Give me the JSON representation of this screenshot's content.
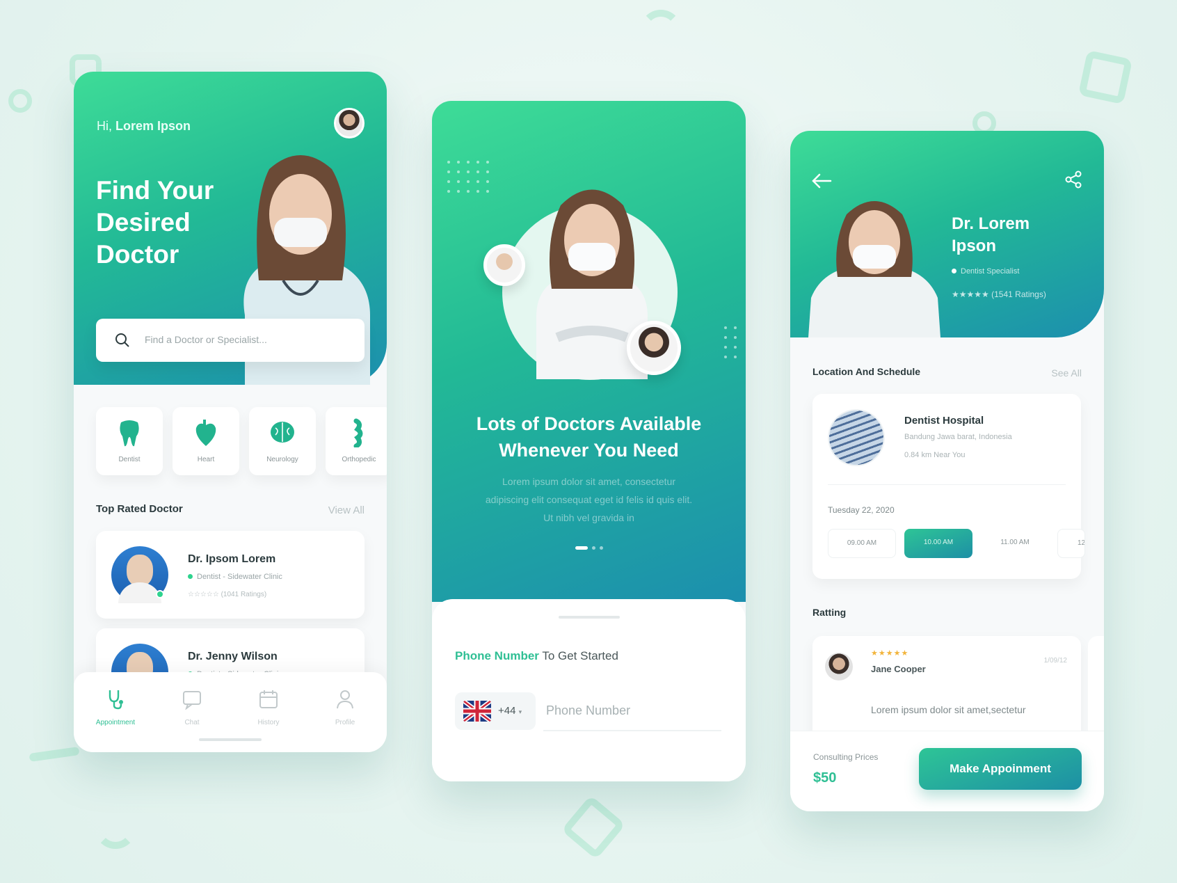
{
  "colors": {
    "accent": "#2fbf94",
    "gradient_start": "#3edc97",
    "gradient_end": "#1c8fae",
    "star": "#f2b43b"
  },
  "home": {
    "greeting_prefix": "Hi,",
    "user_name": "Lorem Ipson",
    "hero_title": "Find Your Desired Doctor",
    "search_placeholder": "Find a Doctor or Specialist...",
    "categories": [
      {
        "label": "Dentist",
        "icon": "tooth-icon"
      },
      {
        "label": "Heart",
        "icon": "heart-icon"
      },
      {
        "label": "Neurology",
        "icon": "brain-icon"
      },
      {
        "label": "Orthopedic",
        "icon": "bone-icon"
      }
    ],
    "top_rated_title": "Top Rated Doctor",
    "view_all": "View All",
    "doctors": [
      {
        "name": "Dr. Ipsom Lorem",
        "specialty": "Dentist - Sidewater Clinic",
        "rating": "☆☆☆☆☆ (1041 Ratings)"
      },
      {
        "name": "Dr. Jenny Wilson",
        "specialty": "Dentist - Sidewater Clinic",
        "rating": ""
      }
    ],
    "tabs": [
      {
        "label": "Appointment",
        "icon": "stethoscope-icon"
      },
      {
        "label": "Chat",
        "icon": "chat-icon"
      },
      {
        "label": "History",
        "icon": "calendar-icon"
      },
      {
        "label": "Profile",
        "icon": "user-icon"
      }
    ]
  },
  "onboarding": {
    "title": "Lots of Doctors Available Whenever You Need",
    "body": "Lorem ipsum dolor sit amet, consectetur adipiscing elit consequat eget id felis id quis elit. Ut nibh vel gravida in",
    "phone_label_bold": "Phone Number",
    "phone_label_rest": "To Get Started",
    "country_code": "+44",
    "phone_placeholder": "Phone Number"
  },
  "detail": {
    "doctor_name": "Dr. Lorem Ipson",
    "specialty": "Dentist Specialist",
    "rating_text": "★★★★★  (1541 Ratings)",
    "location_title": "Location And Schedule",
    "see_all": "See All",
    "hospital_name": "Dentist Hospital",
    "hospital_address": "Bandung Jawa barat, Indonesia",
    "hospital_distance": "0.84 km Near You",
    "date": "Tuesday 22, 2020",
    "slots": [
      "09.00 AM",
      "10.00 AM",
      "11.00 AM",
      "12"
    ],
    "selected_slot": 1,
    "rating_title": "Ratting",
    "review": {
      "stars": "★★★★★",
      "name": "Jane Cooper",
      "date": "1/09/12",
      "text": "Lorem ipsum dolor sit amet,sectetur"
    },
    "price_label": "Consulting Prices",
    "price": "$50",
    "cta": "Make Appoinment"
  }
}
